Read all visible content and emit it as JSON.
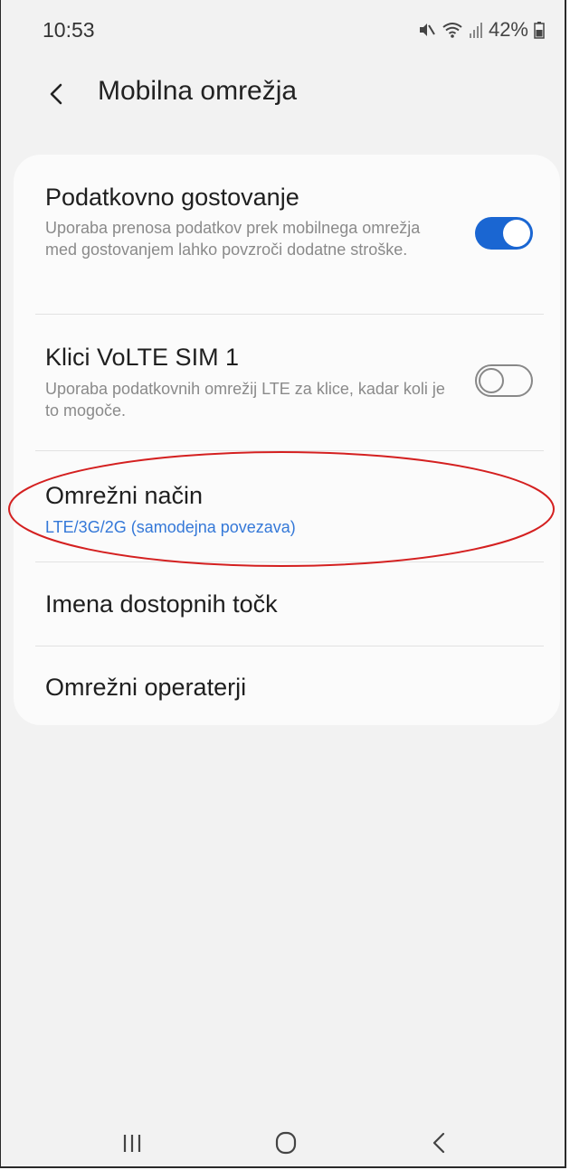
{
  "status_bar": {
    "time": "10:53",
    "battery": "42%"
  },
  "header": {
    "title": "Mobilna omrežja"
  },
  "settings": [
    {
      "title": "Podatkovno gostovanje",
      "subtitle": "Uporaba prenosa podatkov prek mobilnega omrežja med gostovanjem lahko povzroči dodatne stroške.",
      "toggle": true
    },
    {
      "title": "Klici VoLTE SIM 1",
      "subtitle": "Uporaba podatkovnih omrežij LTE za klice, kadar koli je to mogoče.",
      "toggle": false
    },
    {
      "title": "Omrežni način",
      "value": "LTE/3G/2G (samodejna povezava)"
    },
    {
      "title": "Imena dostopnih točk"
    },
    {
      "title": "Omrežni operaterji"
    }
  ],
  "colors": {
    "accent": "#1a66d2",
    "value_text": "#3478d8",
    "annotation": "#d42020",
    "background": "#f2f2f2",
    "card": "#fbfbfb"
  },
  "icons": {
    "back": "chevron-left-icon",
    "status": [
      "mute-icon",
      "wifi-icon",
      "signal-icon",
      "battery-icon"
    ],
    "nav": [
      "recent-apps-icon",
      "home-icon",
      "back-nav-icon"
    ]
  }
}
